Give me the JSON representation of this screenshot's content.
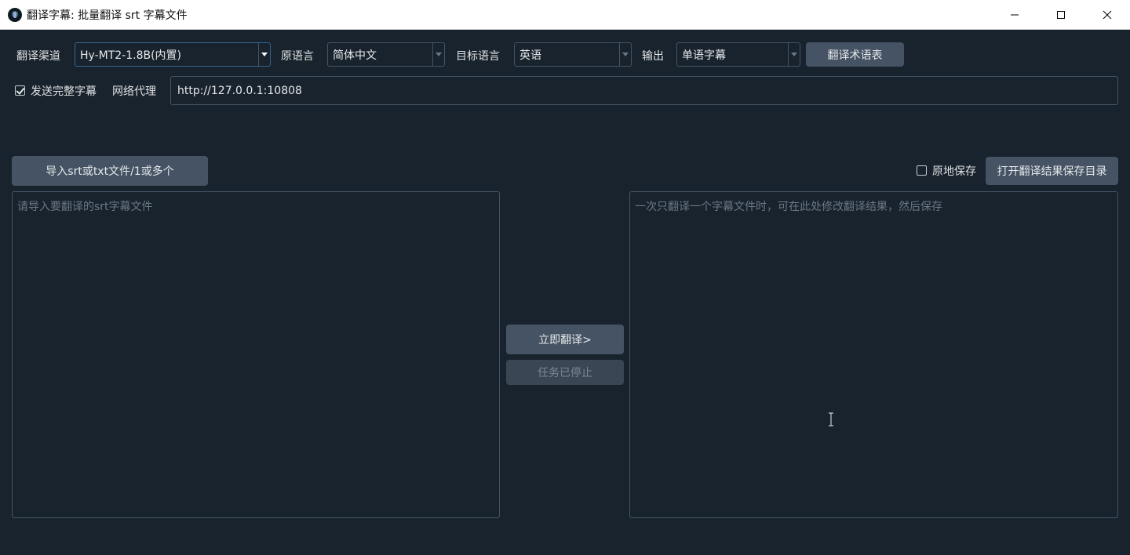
{
  "window": {
    "title": "翻译字幕: 批量翻译 srt 字幕文件",
    "controls": [
      "minimize-icon",
      "maximize-icon",
      "close-icon"
    ]
  },
  "toolbar": {
    "channel_label": "翻译渠道",
    "channel_value": "Hy-MT2-1.8B(内置)",
    "source_lang_label": "原语言",
    "source_lang_value": "简体中文",
    "target_lang_label": "目标语言",
    "target_lang_value": "英语",
    "output_label": "输出",
    "output_value": "单语字幕",
    "glossary_button": "翻译术语表"
  },
  "options": {
    "send_full_subtitle_label": "发送完整字幕",
    "send_full_subtitle_checked": true,
    "proxy_label": "网络代理",
    "proxy_value": "http://127.0.0.1:10808"
  },
  "actions": {
    "import_button": "导入srt或txt文件/1或多个",
    "save_in_place_label": "原地保存",
    "save_in_place_checked": false,
    "open_result_dir_button": "打开翻译结果保存目录",
    "translate_button": "立即翻译>",
    "stop_button": "任务已停止"
  },
  "panels": {
    "source_placeholder": "请导入要翻译的srt字幕文件",
    "result_placeholder": "一次只翻译一个字幕文件时，可在此处修改翻译结果，然后保存"
  },
  "colors": {
    "background": "#19232d",
    "button": "#455364",
    "border": "#455364",
    "focus_border": "#346792",
    "text": "#dfe1e2",
    "placeholder": "#6b7785"
  }
}
